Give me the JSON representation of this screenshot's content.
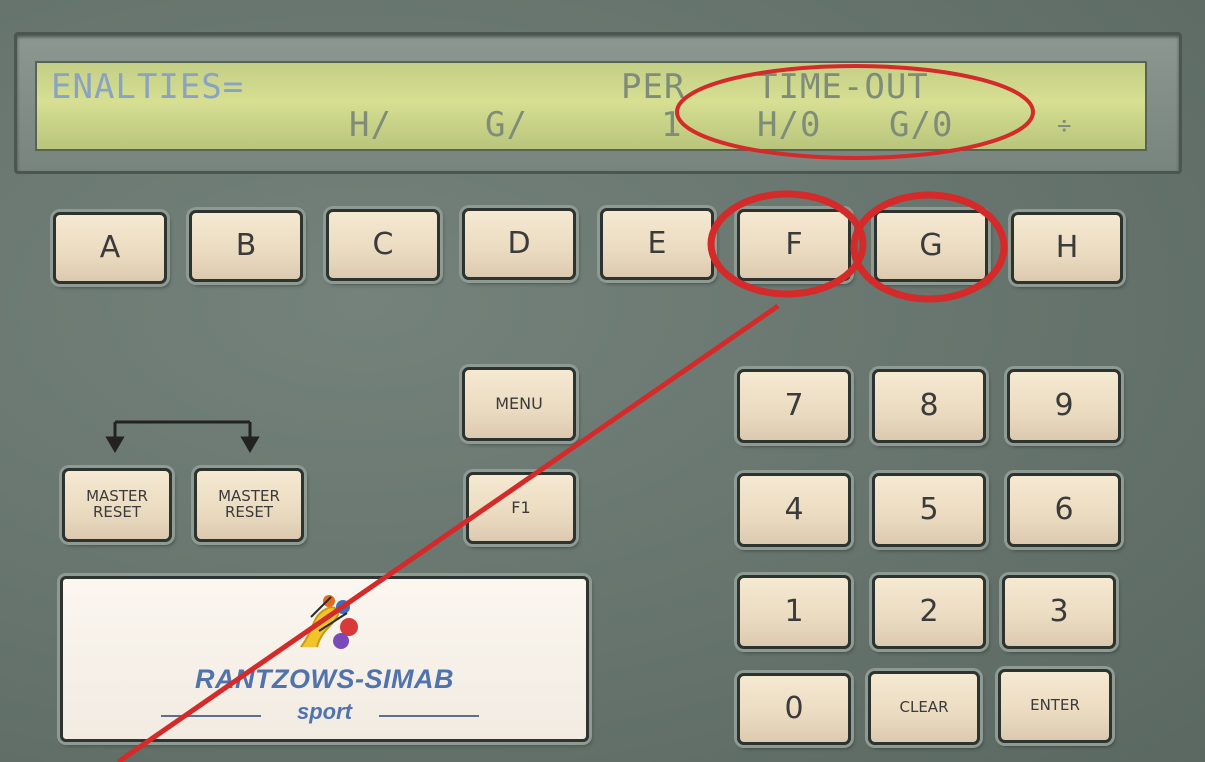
{
  "display": {
    "row1_penalties": "ENALTIES=",
    "row1_per": "PER",
    "row1_timeout": "TIME-OUT",
    "row2_home": "H/",
    "row2_guest": "G/",
    "row2_period": "1",
    "row2_timeout_home": "H/0",
    "row2_timeout_guest": "G/0",
    "row2_symbol": "÷"
  },
  "function_keys": [
    "A",
    "B",
    "C",
    "D",
    "E",
    "F",
    "G",
    "H"
  ],
  "menu_key": "MENU",
  "f1_key": "F1",
  "master_reset": [
    "MASTER\nRESET",
    "MASTER\nRESET"
  ],
  "keypad": {
    "k7": "7",
    "k8": "8",
    "k9": "9",
    "k4": "4",
    "k5": "5",
    "k6": "6",
    "k1": "1",
    "k2": "2",
    "k3": "3",
    "k0": "0",
    "clear": "CLEAR",
    "enter": "ENTER"
  },
  "logo": {
    "name": "RANTZOWS-SIMAB",
    "sub": "sport",
    "brand_color": "#5173ad"
  },
  "annotation": {
    "color": "#d42a2a",
    "highlighted": [
      "TIME-OUT display",
      "F key",
      "G key"
    ]
  }
}
